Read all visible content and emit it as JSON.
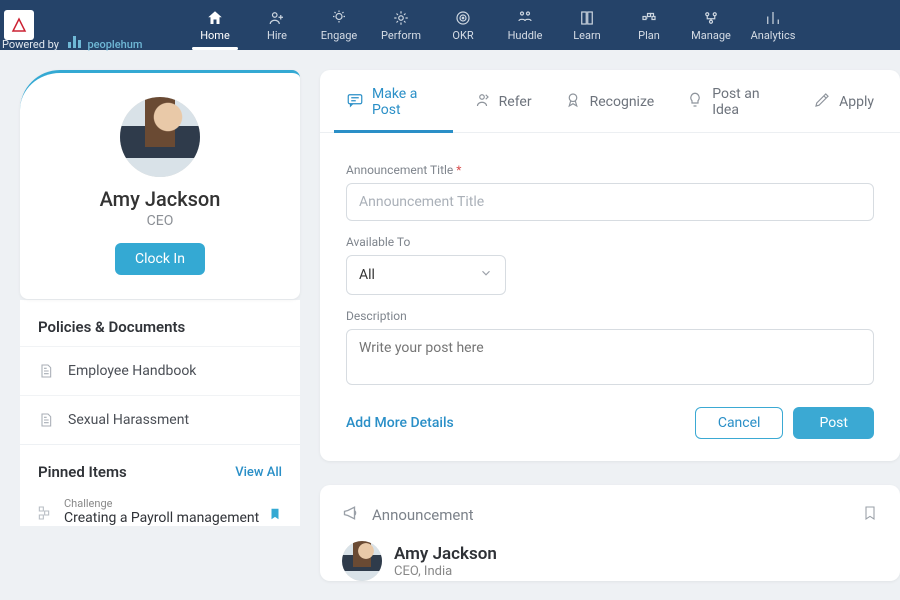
{
  "powered_by_prefix": "Powered by",
  "powered_by_brand": "peoplehum",
  "nav": [
    {
      "label": "Home",
      "icon": "home",
      "active": true
    },
    {
      "label": "Hire",
      "icon": "hire"
    },
    {
      "label": "Engage",
      "icon": "engage"
    },
    {
      "label": "Perform",
      "icon": "perform"
    },
    {
      "label": "OKR",
      "icon": "okr"
    },
    {
      "label": "Huddle",
      "icon": "huddle"
    },
    {
      "label": "Learn",
      "icon": "learn"
    },
    {
      "label": "Plan",
      "icon": "plan"
    },
    {
      "label": "Manage",
      "icon": "manage"
    },
    {
      "label": "Analytics",
      "icon": "analytics"
    }
  ],
  "profile": {
    "name": "Amy Jackson",
    "role": "CEO",
    "clock_label": "Clock In"
  },
  "policies": {
    "heading": "Policies & Documents",
    "items": [
      "Employee Handbook",
      "Sexual Harassment"
    ]
  },
  "pinned": {
    "heading": "Pinned Items",
    "view_all": "View All",
    "items": [
      {
        "type": "Challenge",
        "title": "Creating a Payroll management"
      }
    ]
  },
  "post_tabs": [
    "Make a Post",
    "Refer",
    "Recognize",
    "Post an Idea",
    "Apply"
  ],
  "form": {
    "title_label": "Announcement Title",
    "title_placeholder": "Announcement Title",
    "available_label": "Available To",
    "available_value": "All",
    "desc_label": "Description",
    "desc_placeholder": "Write your post here",
    "add_more": "Add More Details",
    "cancel": "Cancel",
    "post": "Post"
  },
  "announcement": {
    "heading": "Announcement",
    "user_name": "Amy Jackson",
    "user_sub": "CEO, India"
  }
}
